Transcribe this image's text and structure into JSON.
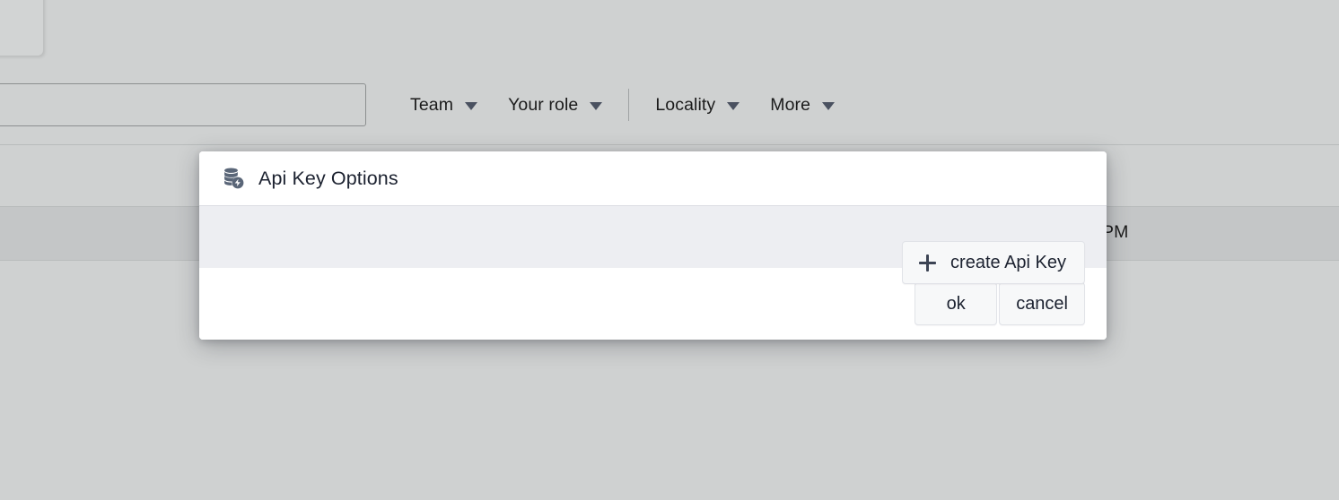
{
  "background": {
    "corner_card": {
      "name": "panel-card"
    },
    "search": {
      "value": "",
      "placeholder": ""
    },
    "toolbar": {
      "filters": [
        {
          "label": "Team",
          "icon": "chevron-down-icon"
        },
        {
          "label": "Your role",
          "icon": "chevron-down-icon"
        },
        {
          "label": "Locality",
          "icon": "chevron-down-icon"
        },
        {
          "label": "More",
          "icon": "chevron-down-icon"
        }
      ]
    },
    "table": {
      "rows": [
        {
          "time": "PM"
        }
      ]
    }
  },
  "modal": {
    "icon": "database-lightning-icon",
    "title": "Api Key Options",
    "body": {
      "create_button": {
        "label": "create Api Key",
        "icon": "plus-icon"
      }
    },
    "footer": {
      "ok_label": "ok",
      "cancel_label": "cancel"
    }
  },
  "colors": {
    "page_background": "#cfd1d1",
    "modal_background": "#ffffff",
    "modal_body_background": "#edeef2",
    "button_background": "#f7f8f9",
    "text_primary": "#1c2230",
    "icon_accent": "#5a6678"
  }
}
